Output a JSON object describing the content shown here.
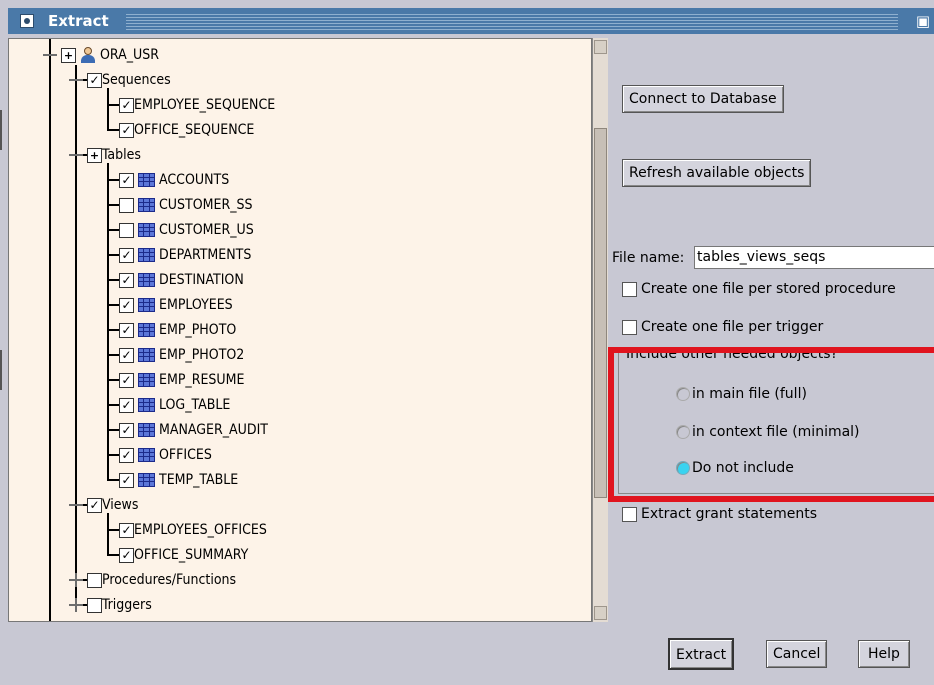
{
  "window": {
    "title": "Extract",
    "icon": "window-menu-icon",
    "maximize_icon": "maximize-icon"
  },
  "tree": {
    "root": {
      "label": "ORA_USR",
      "icon": "user-icon"
    },
    "nodes": [
      {
        "label": "Sequences",
        "checked": true,
        "level": 1
      },
      {
        "label": "EMPLOYEE_SEQUENCE",
        "checked": true,
        "level": 2
      },
      {
        "label": "OFFICE_SEQUENCE",
        "checked": true,
        "level": 2
      },
      {
        "label": "Tables",
        "checked": false,
        "level": 1
      },
      {
        "label": "ACCOUNTS",
        "checked": true,
        "level": 2,
        "icon": "table-icon"
      },
      {
        "label": "CUSTOMER_SS",
        "checked": false,
        "level": 2,
        "icon": "table-icon"
      },
      {
        "label": "CUSTOMER_US",
        "checked": false,
        "level": 2,
        "icon": "table-icon"
      },
      {
        "label": "DEPARTMENTS",
        "checked": true,
        "level": 2,
        "icon": "table-icon"
      },
      {
        "label": "DESTINATION",
        "checked": true,
        "level": 2,
        "icon": "table-icon"
      },
      {
        "label": "EMPLOYEES",
        "checked": true,
        "level": 2,
        "icon": "table-icon"
      },
      {
        "label": "EMP_PHOTO",
        "checked": true,
        "level": 2,
        "icon": "table-icon"
      },
      {
        "label": "EMP_PHOTO2",
        "checked": true,
        "level": 2,
        "icon": "table-icon"
      },
      {
        "label": "EMP_RESUME",
        "checked": true,
        "level": 2,
        "icon": "table-icon"
      },
      {
        "label": "LOG_TABLE",
        "checked": true,
        "level": 2,
        "icon": "table-icon"
      },
      {
        "label": "MANAGER_AUDIT",
        "checked": true,
        "level": 2,
        "icon": "table-icon"
      },
      {
        "label": "OFFICES",
        "checked": true,
        "level": 2,
        "icon": "table-icon"
      },
      {
        "label": "TEMP_TABLE",
        "checked": true,
        "level": 2,
        "icon": "table-icon"
      },
      {
        "label": "Views",
        "checked": true,
        "level": 1
      },
      {
        "label": "EMPLOYEES_OFFICES",
        "checked": true,
        "level": 2
      },
      {
        "label": "OFFICE_SUMMARY",
        "checked": true,
        "level": 2
      },
      {
        "label": "Procedures/Functions",
        "checked": false,
        "level": 1
      },
      {
        "label": "Triggers",
        "checked": false,
        "level": 1
      }
    ]
  },
  "buttons": {
    "connect": "Connect to Database",
    "refresh": "Refresh available objects",
    "extract": "Extract",
    "cancel": "Cancel",
    "help": "Help"
  },
  "file": {
    "label": "File name:",
    "value": "tables_views_seqs"
  },
  "options": {
    "one_file_per_proc": "Create one file per stored procedure",
    "one_file_per_trigger": "Create one file per trigger",
    "grant": "Extract grant statements"
  },
  "include_group": {
    "label": "Include other needed objects?",
    "choices": [
      "in main file (full)",
      "in context file (minimal)",
      "Do not include"
    ],
    "selected_index": 2
  },
  "colors": {
    "highlight_box": "#e0141e",
    "titlebar": "#4a79a8",
    "tree_bg": "#fdf3e8",
    "selected_radio": "#39d3f0"
  }
}
